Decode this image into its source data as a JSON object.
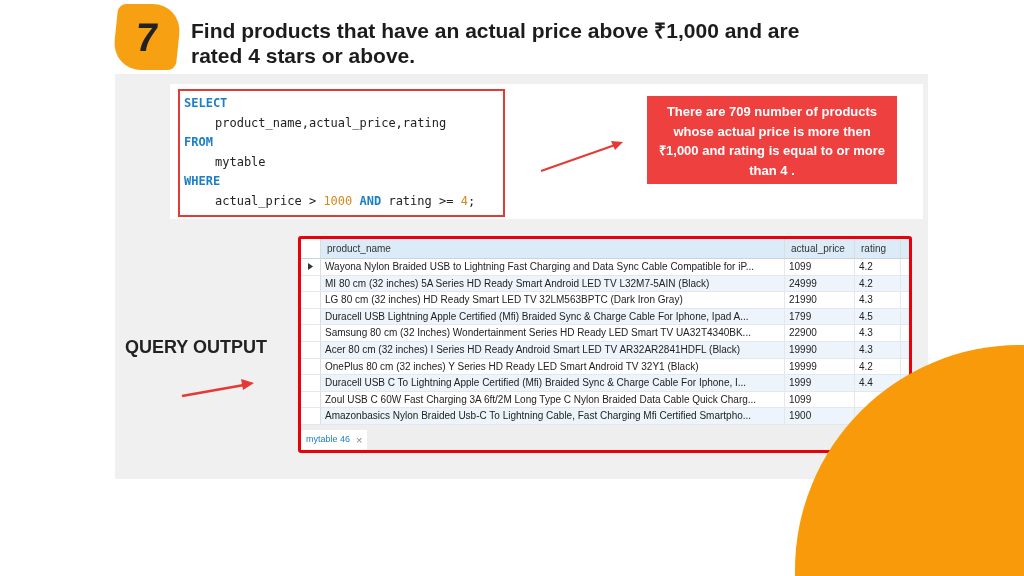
{
  "step_badge": "7",
  "title": "Find products that have an actual price above ₹1,000 and are rated 4 stars or above.",
  "code_lines": [
    {
      "indent": false,
      "tokens": [
        {
          "kind": "keyword",
          "text": "SELECT"
        }
      ]
    },
    {
      "indent": true,
      "tokens": [
        {
          "kind": "plain",
          "text": "product_name,actual_price,rating"
        }
      ]
    },
    {
      "indent": false,
      "tokens": [
        {
          "kind": "keyword",
          "text": "FROM"
        }
      ]
    },
    {
      "indent": true,
      "tokens": [
        {
          "kind": "plain",
          "text": "mytable"
        }
      ]
    },
    {
      "indent": false,
      "tokens": [
        {
          "kind": "keyword",
          "text": "WHERE"
        }
      ]
    },
    {
      "indent": true,
      "tokens": [
        {
          "kind": "plain",
          "text": "actual_price > "
        },
        {
          "kind": "number",
          "text": "1000"
        },
        {
          "kind": "keyword",
          "text": " AND"
        },
        {
          "kind": "plain",
          "text": " rating >= "
        },
        {
          "kind": "number",
          "text": "4"
        },
        {
          "kind": "plain",
          "text": ";"
        }
      ]
    }
  ],
  "callout": "There are 709 number of products whose actual price is more then ₹1,000 and rating is equal to or more than 4 .",
  "output_label": "QUERY OUTPUT",
  "table": {
    "columns": [
      "product_name",
      "actual_price",
      "rating"
    ],
    "rows": [
      {
        "current": true,
        "cells": [
          "Wayona Nylon Braided USB to Lightning Fast Charging and Data Sync Cable Compatible for iP...",
          "1099",
          "4.2"
        ]
      },
      {
        "current": false,
        "cells": [
          "MI 80 cm (32 inches) 5A Series HD Ready Smart Android LED TV L32M7-5AIN (Black)",
          "24999",
          "4.2"
        ]
      },
      {
        "current": false,
        "cells": [
          "LG 80 cm (32 inches) HD Ready Smart LED TV 32LM563BPTC (Dark Iron Gray)",
          "21990",
          "4.3"
        ]
      },
      {
        "current": false,
        "cells": [
          "Duracell USB Lightning Apple Certified (Mfi) Braided Sync & Charge Cable For Iphone, Ipad A...",
          "1799",
          "4.5"
        ]
      },
      {
        "current": false,
        "cells": [
          "Samsung 80 cm (32 Inches) Wondertainment Series HD Ready LED Smart TV UA32T4340BK...",
          "22900",
          "4.3"
        ]
      },
      {
        "current": false,
        "cells": [
          "Acer 80 cm (32 inches) I Series HD Ready Android Smart LED TV AR32AR2841HDFL (Black)",
          "19990",
          "4.3"
        ]
      },
      {
        "current": false,
        "cells": [
          "OnePlus 80 cm (32 inches) Y Series HD Ready LED Smart Android TV 32Y1 (Black)",
          "19999",
          "4.2"
        ]
      },
      {
        "current": false,
        "cells": [
          "Duracell USB C To Lightning Apple Certified (Mfi) Braided Sync & Charge Cable For Iphone, I...",
          "1999",
          "4.4"
        ]
      },
      {
        "current": false,
        "cells": [
          "Zoul USB C 60W Fast Charging 3A 6ft/2M Long Type C Nylon Braided Data Cable Quick Charg...",
          "1099"
        ]
      },
      {
        "current": false,
        "cells": [
          "Amazonbasics Nylon Braided Usb-C To Lightning Cable, Fast Charging Mfi Certified Smartpho...",
          "1900"
        ]
      }
    ]
  },
  "result_tab": {
    "label": "mytable 46",
    "close": "×"
  }
}
